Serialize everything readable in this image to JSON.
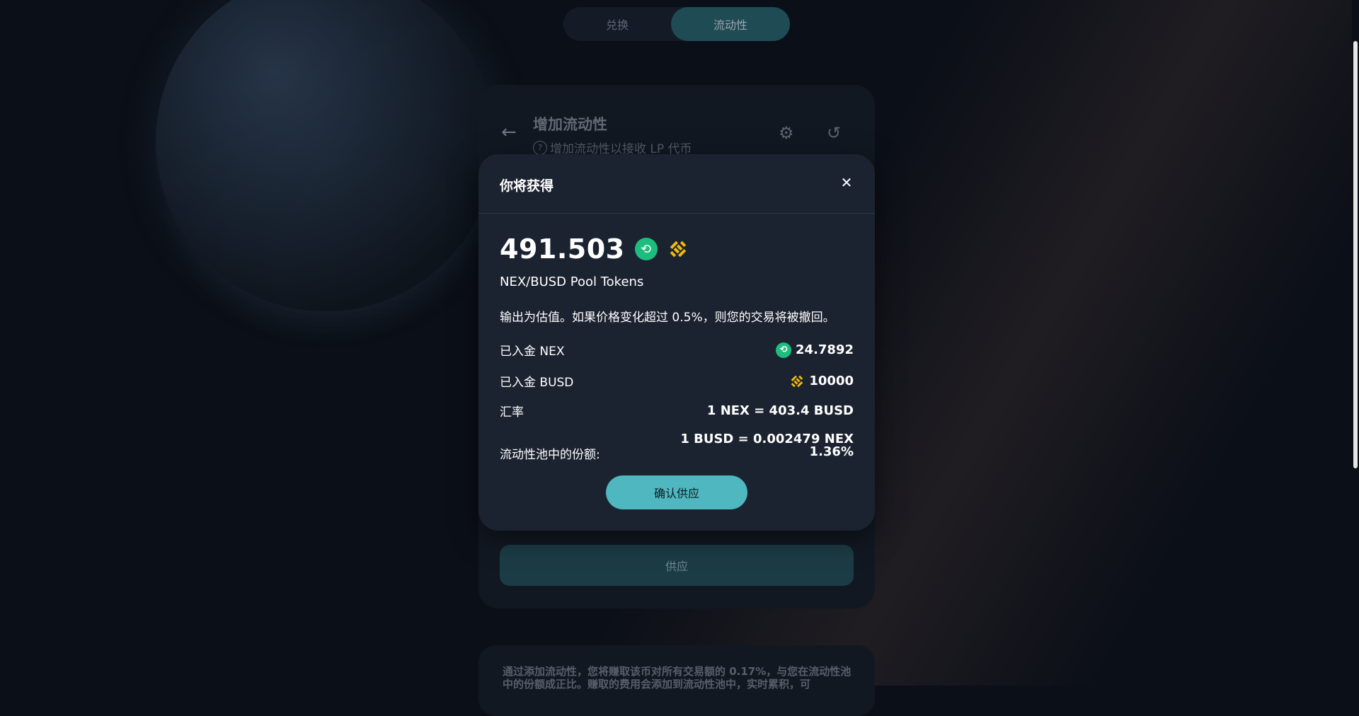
{
  "top_toggle": {
    "swap_label": "兑换",
    "liquidity_label": "流动性"
  },
  "card": {
    "title": "增加流动性",
    "subtitle": "增加流动性以接收 LP 代币",
    "supply_label": "供应"
  },
  "bottom_info": "通过添加流动性，您将赚取该币对所有交易额的 0.17%，与您在流动性池中的份额成正比。赚取的费用会添加到流动性池中，实时累积，可",
  "modal": {
    "title": "你将获得",
    "amount": "491.503",
    "pool_tokens_label": "NEX/BUSD Pool Tokens",
    "notice": "输出为估值。如果价格变化超过 0.5%，则您的交易将被撤回。",
    "deposited_nex_label": "已入金 NEX",
    "deposited_nex_value": "24.7892",
    "deposited_busd_label": "已入金 BUSD",
    "deposited_busd_value": "10000",
    "rate_label": "汇率",
    "rate_value_1": "1 NEX = 403.4 BUSD",
    "rate_value_2": "1 BUSD = 0.002479 NEX",
    "share_label": "流动性池中的份额:",
    "share_value": "1.36%",
    "confirm_label": "确认供应"
  },
  "icons": {
    "nex": "nex-token-icon",
    "busd": "busd-token-icon",
    "close": "close-icon",
    "back": "back-arrow-icon",
    "settings": "gear-icon",
    "history": "history-icon",
    "help": "question-circle-icon"
  },
  "colors": {
    "accent": "#4fb7bf",
    "nex_green": "#1dbd7e",
    "busd_yellow": "#f0b90b",
    "modal_bg": "#1c2330"
  }
}
